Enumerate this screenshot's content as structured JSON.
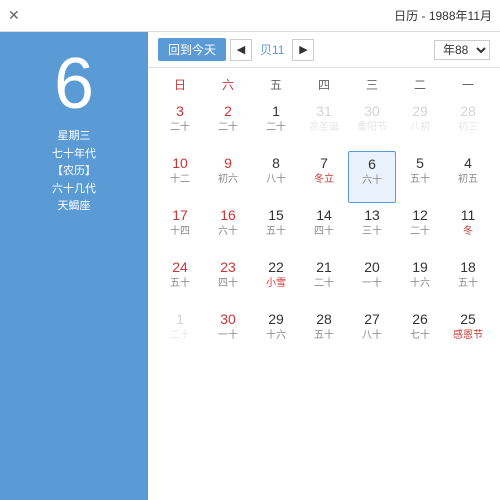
{
  "titlebar": {
    "close_label": "✕",
    "title": "日历 - 1988年11月"
  },
  "header": {
    "today_btn": "回到今天",
    "prev_label": "◀",
    "next_label": "▶",
    "month_label": "贝11",
    "year_label": "年88"
  },
  "day_headers": [
    {
      "label": "日",
      "weekend": true
    },
    {
      "label": "六",
      "weekend": true
    },
    {
      "label": "五",
      "weekend": false
    },
    {
      "label": "四",
      "weekend": false
    },
    {
      "label": "三",
      "weekend": false
    },
    {
      "label": "二",
      "weekend": false
    },
    {
      "label": "一",
      "weekend": false
    }
  ],
  "sidebar": {
    "day_num": "6",
    "line1": "星期三",
    "line2": "七十年代",
    "line3": "【农历】",
    "line4": "六十几代",
    "line5": "天蝎座"
  },
  "weeks": [
    [
      {
        "solar": "3",
        "lunar": "二十",
        "weekend": true,
        "other_month": false
      },
      {
        "solar": "2",
        "lunar": "二十",
        "weekend": true,
        "other_month": false
      },
      {
        "solar": "1",
        "lunar": "二十",
        "weekend": false,
        "other_month": false
      },
      {
        "solar": "31",
        "lunar": "农圣诞",
        "weekend": false,
        "other_month": true,
        "holiday": true
      },
      {
        "solar": "30",
        "lunar": "重阳节",
        "weekend": false,
        "other_month": true,
        "holiday": true
      },
      {
        "solar": "29",
        "lunar": "八初",
        "weekend": false,
        "other_month": true
      },
      {
        "solar": "28",
        "lunar": "初三",
        "weekend": false,
        "other_month": true
      }
    ],
    [
      {
        "solar": "10",
        "lunar": "十二",
        "weekend": true,
        "other_month": false
      },
      {
        "solar": "9",
        "lunar": "初六",
        "weekend": true,
        "other_month": false
      },
      {
        "solar": "8",
        "lunar": "八十",
        "weekend": false,
        "other_month": false
      },
      {
        "solar": "7",
        "lunar": "冬立",
        "weekend": false,
        "other_month": false,
        "holiday": true
      },
      {
        "solar": "6",
        "lunar": "六十",
        "weekend": false,
        "other_month": false,
        "today": true
      },
      {
        "solar": "5",
        "lunar": "五十",
        "weekend": false,
        "other_month": false
      },
      {
        "solar": "4",
        "lunar": "初五",
        "weekend": false,
        "other_month": false
      }
    ],
    [
      {
        "solar": "17",
        "lunar": "十四",
        "weekend": true,
        "other_month": false
      },
      {
        "solar": "16",
        "lunar": "六十",
        "weekend": true,
        "other_month": false
      },
      {
        "solar": "15",
        "lunar": "五十",
        "weekend": false,
        "other_month": false
      },
      {
        "solar": "14",
        "lunar": "四十",
        "weekend": false,
        "other_month": false
      },
      {
        "solar": "13",
        "lunar": "三十",
        "weekend": false,
        "other_month": false
      },
      {
        "solar": "12",
        "lunar": "二十",
        "weekend": false,
        "other_month": false
      },
      {
        "solar": "11",
        "lunar": "冬",
        "weekend": false,
        "other_month": false,
        "holiday": true
      }
    ],
    [
      {
        "solar": "24",
        "lunar": "五十",
        "weekend": true,
        "other_month": false
      },
      {
        "solar": "23",
        "lunar": "四十",
        "weekend": true,
        "other_month": false
      },
      {
        "solar": "22",
        "lunar": "小雪",
        "weekend": false,
        "other_month": false,
        "holiday": true
      },
      {
        "solar": "21",
        "lunar": "二十",
        "weekend": false,
        "other_month": false
      },
      {
        "solar": "20",
        "lunar": "一十",
        "weekend": false,
        "other_month": false
      },
      {
        "solar": "19",
        "lunar": "十六",
        "weekend": false,
        "other_month": false
      },
      {
        "solar": "18",
        "lunar": "五十",
        "weekend": false,
        "other_month": false
      }
    ],
    [
      {
        "solar": "1",
        "lunar": "二十",
        "weekend": true,
        "other_month": true
      },
      {
        "solar": "30",
        "lunar": "一十",
        "weekend": true,
        "other_month": false
      },
      {
        "solar": "29",
        "lunar": "十六",
        "weekend": false,
        "other_month": false
      },
      {
        "solar": "28",
        "lunar": "五十",
        "weekend": false,
        "other_month": false
      },
      {
        "solar": "27",
        "lunar": "八十",
        "weekend": false,
        "other_month": false
      },
      {
        "solar": "26",
        "lunar": "七十",
        "weekend": false,
        "other_month": false
      },
      {
        "solar": "25",
        "lunar": "感恩节",
        "weekend": false,
        "other_month": false,
        "holiday": true
      }
    ]
  ]
}
